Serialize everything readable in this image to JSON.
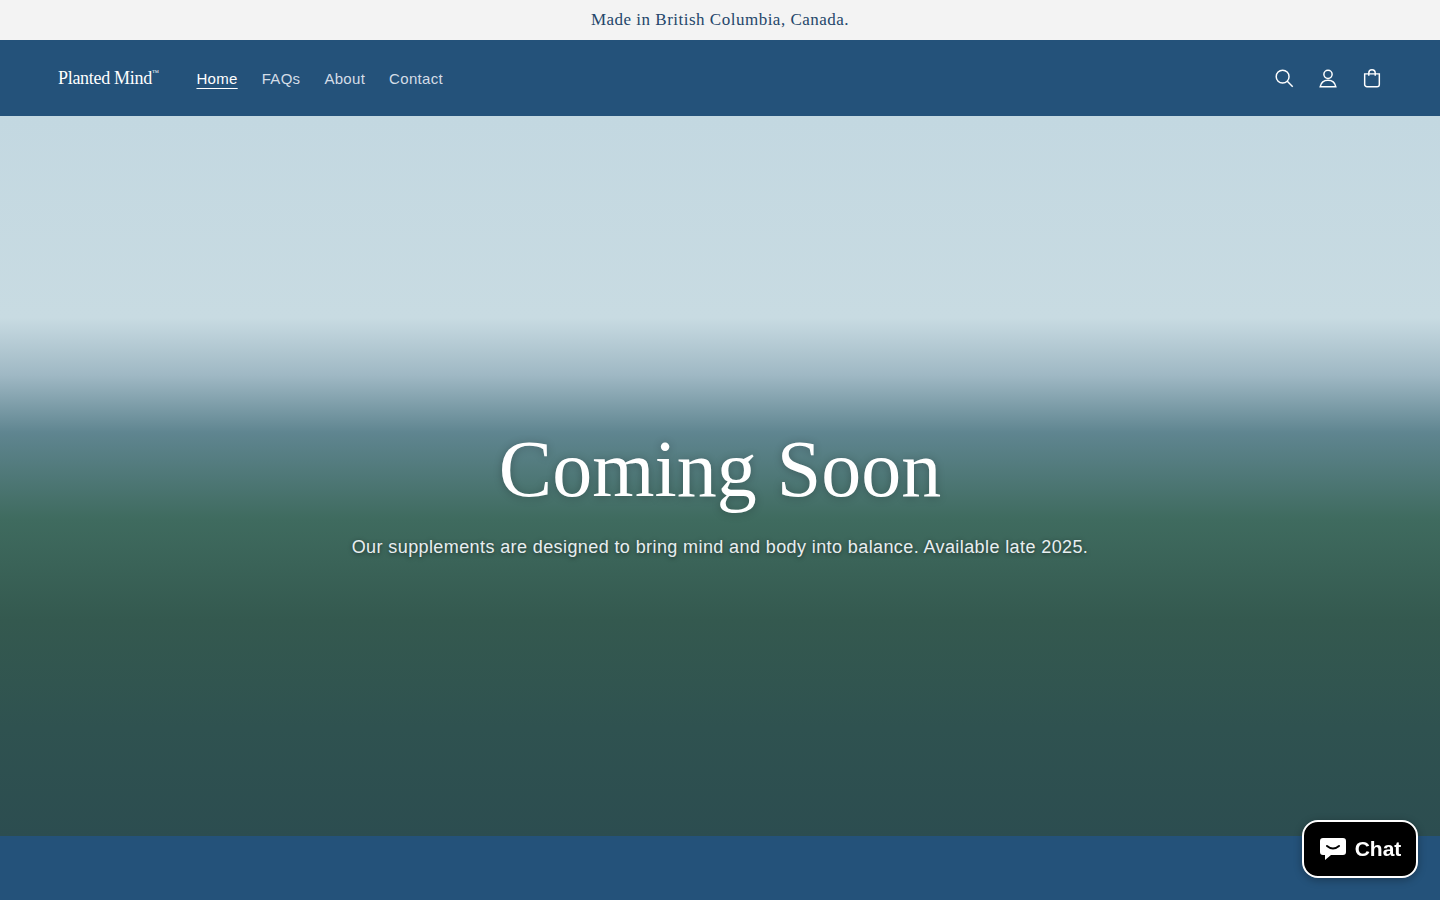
{
  "announcement": "Made in British Columbia, Canada.",
  "logo": {
    "name": "Planted Mind",
    "mark": "™"
  },
  "nav": [
    {
      "label": "Home",
      "selected": true
    },
    {
      "label": "FAQs",
      "selected": false
    },
    {
      "label": "About",
      "selected": false
    },
    {
      "label": "Contact",
      "selected": false
    }
  ],
  "hero": {
    "title": "Coming Soon",
    "subtitle": "Our supplements are designed to bring mind and body into balance. Available late 2025."
  },
  "chat": {
    "label": "Chat"
  }
}
